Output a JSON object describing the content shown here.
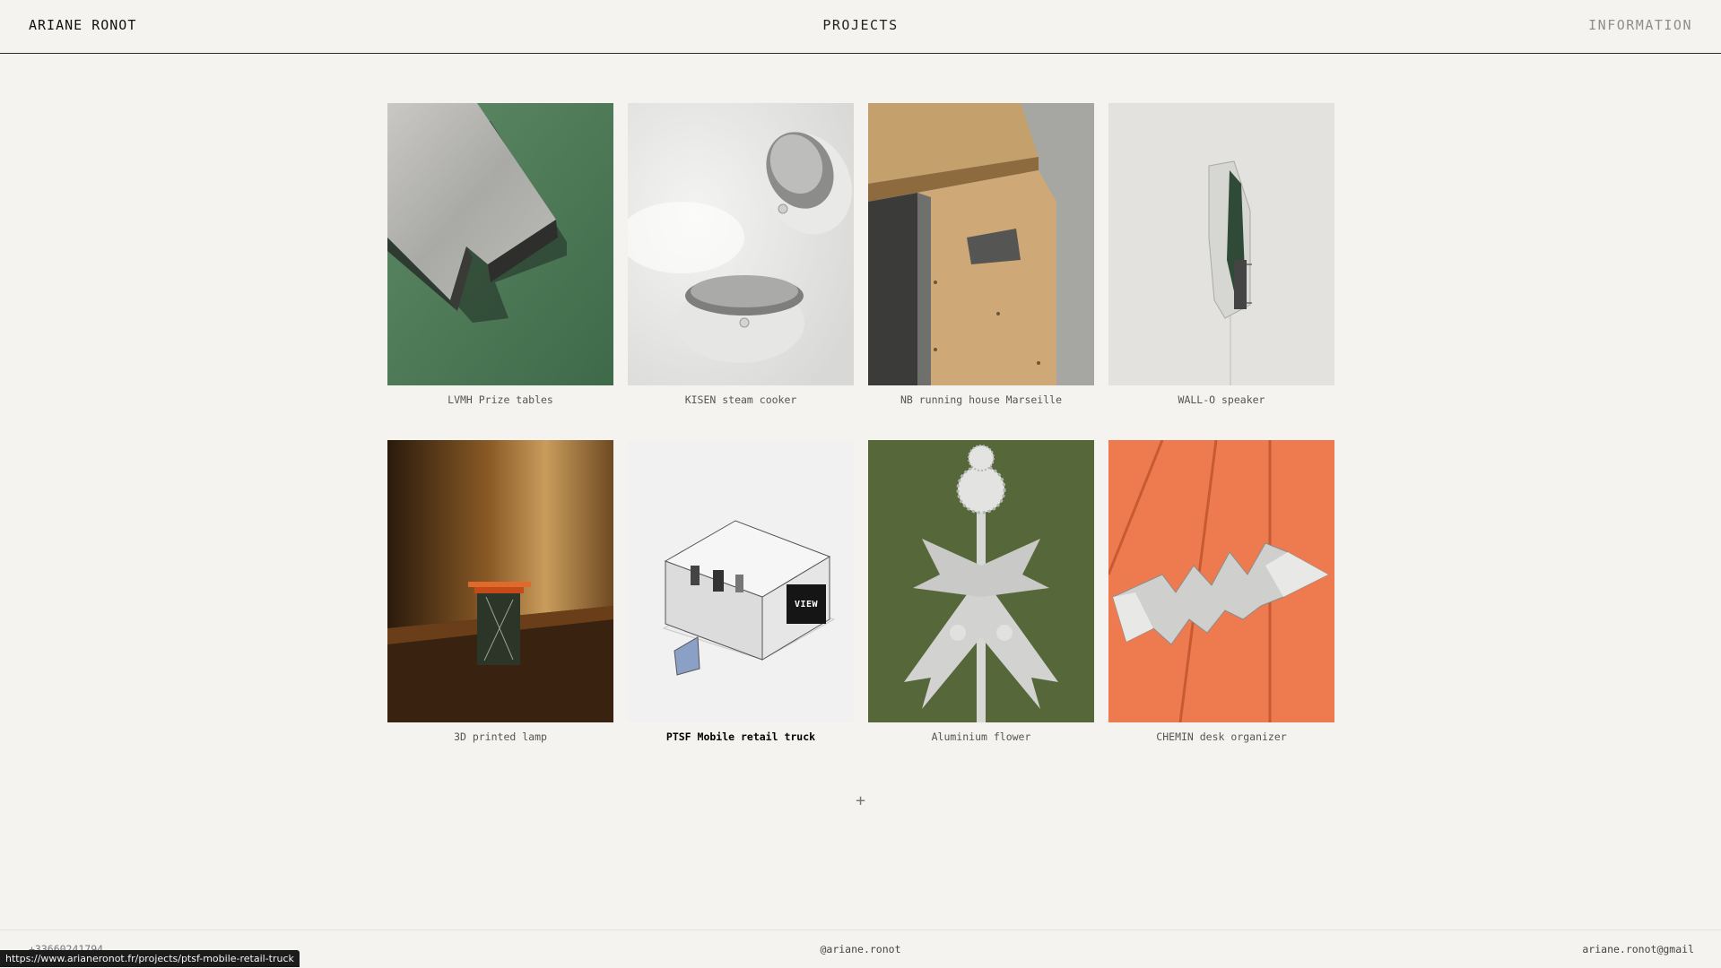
{
  "header": {
    "brand": "ARIANE RONOT",
    "nav_projects": "PROJECTS",
    "nav_information": "INFORMATION"
  },
  "projects": [
    {
      "title": "LVMH Prize tables"
    },
    {
      "title": "KISEN steam cooker"
    },
    {
      "title": "NB running house Marseille"
    },
    {
      "title": "WALL-O speaker"
    },
    {
      "title": "3D printed lamp"
    },
    {
      "title": "PTSF Mobile retail truck",
      "hover_label": "VIEW"
    },
    {
      "title": "Aluminium flower"
    },
    {
      "title": "CHEMIN desk organizer"
    }
  ],
  "load_more": "+",
  "footer": {
    "phone": "+33660241794",
    "instagram": "@ariane.ronot",
    "email": "ariane.ronot@gmail"
  },
  "status_url": "https://www.arianeronot.fr/projects/ptsf-mobile-retail-truck"
}
